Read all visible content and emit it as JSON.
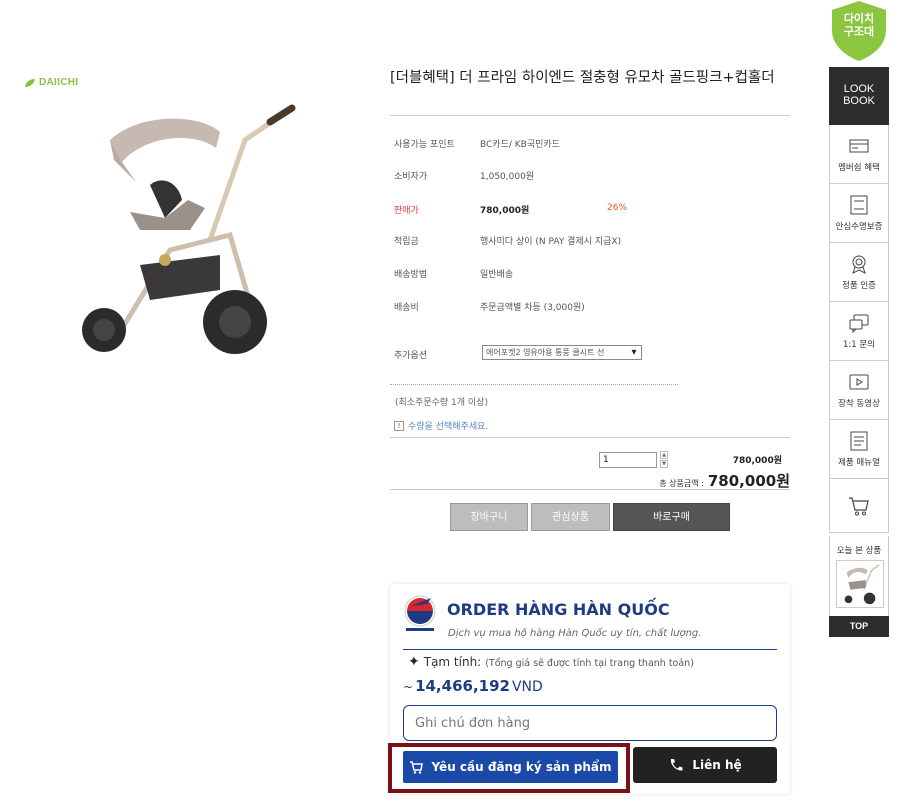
{
  "brand": {
    "name": "DAIICHI",
    "color": "#8cbf3f"
  },
  "product": {
    "title": "[더블혜택] 더 프라임 하이엔드 절충형 유모차 골드핑크+컵홀더",
    "image_alt": "stroller-image"
  },
  "info": [
    {
      "label": "사용가능 포인트",
      "value": "BC카드/ KB국민카드"
    },
    {
      "label": "소비자가",
      "value": "1,050,000원"
    },
    {
      "label": "판매가",
      "value": "780,000원",
      "discount": "26%"
    },
    {
      "label": "적립금",
      "value": "행사미다 상이 (N PAY 결제시 지급X)"
    },
    {
      "label": "배송방법",
      "value": "일반배송"
    },
    {
      "label": "배송비",
      "value": "주문금액별 차등 (3,000원)"
    }
  ],
  "option": {
    "label": "추가옵션",
    "selected": "에어포켓2 영유아용 통풍 쿨시트 선"
  },
  "min_qty": "(최소주문수량 1개 이상)",
  "qty_note": "수량을 선택해주세요.",
  "quantity": {
    "value": "1",
    "line_price": "780,000원"
  },
  "total": {
    "label": "총 상품금액 :",
    "value": "780,000원"
  },
  "buttons": {
    "cart": "장바구니",
    "wish": "관심상품",
    "buy": "바로구매"
  },
  "order": {
    "title": "ORDER HÀNG HÀN QUỐC",
    "subtitle": "Dịch vụ mua hộ hàng Hàn Quốc uy tín, chất lượng.",
    "estimate_label": "Tạm tính:",
    "estimate_note": "(Tổng giá sẽ được tính tại trang thanh toán)",
    "tilde": "~",
    "amount": "14,466,192",
    "currency": "VND",
    "note_placeholder": "Ghi chú đơn hàng",
    "request_button": "Yêu cầu đăng ký sản phẩm",
    "contact_button": "Liên hệ",
    "accent": "#1d3c83",
    "highlight": "#7a1116"
  },
  "sidebar": {
    "badge": [
      "다이치",
      "구조대"
    ],
    "lookbook": [
      "LOOK",
      "BOOK"
    ],
    "items": [
      {
        "label": "멤버쉽 혜택",
        "icon": "card-icon"
      },
      {
        "label": "안심수명보증",
        "icon": "document-icon"
      },
      {
        "label": "정품 인증",
        "icon": "medal-icon"
      },
      {
        "label": "1:1 문의",
        "icon": "chat-icon"
      },
      {
        "label": "장착 동영상",
        "icon": "video-icon"
      },
      {
        "label": "제품 매뉴얼",
        "icon": "manual-icon"
      }
    ],
    "today_label": "오늘 본 상품",
    "top": "TOP"
  }
}
